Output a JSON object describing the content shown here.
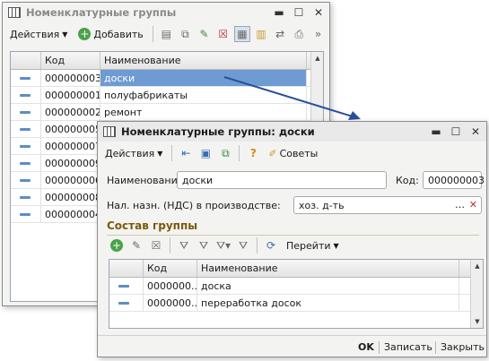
{
  "back_window": {
    "title": "Номенклатурные группы",
    "toolbar": {
      "actions_label": "Действия",
      "add_label": "Добавить"
    },
    "columns": [
      "Код",
      "Наименование"
    ],
    "rows": [
      {
        "code": "000000003",
        "name": "доски",
        "selected": true
      },
      {
        "code": "000000001",
        "name": "полуфабрикаты"
      },
      {
        "code": "000000002",
        "name": "ремонт"
      },
      {
        "code": "000000005",
        "name": ""
      },
      {
        "code": "000000007",
        "name": ""
      },
      {
        "code": "000000009",
        "name": ""
      },
      {
        "code": "000000006",
        "name": ""
      },
      {
        "code": "000000008",
        "name": ""
      },
      {
        "code": "000000004",
        "name": ""
      }
    ]
  },
  "front_window": {
    "title": "Номенклатурные группы: доски",
    "toolbar": {
      "actions_label": "Действия",
      "tips_label": "Советы"
    },
    "name_label": "Наименование:",
    "name_value": "доски",
    "code_label": "Код:",
    "code_value": "000000003",
    "vat_label": "Нал. назн. (НДС) в производстве:",
    "vat_value": "хоз. д-ть",
    "group_section_title": "Состав группы",
    "group_toolbar": {
      "goto_label": "Перейти"
    },
    "columns": [
      "Код",
      "Наименование"
    ],
    "rows": [
      {
        "code": "0000000...",
        "name": "доска"
      },
      {
        "code": "0000000...",
        "name": "переработка досок"
      }
    ],
    "footer": {
      "ok_label": "OK",
      "save_label": "Записать",
      "close_label": "Закрыть"
    }
  },
  "colors": {
    "selection": "#6f9bd3",
    "arrow": "#2a4f9a",
    "section": "#7a5a0a"
  }
}
